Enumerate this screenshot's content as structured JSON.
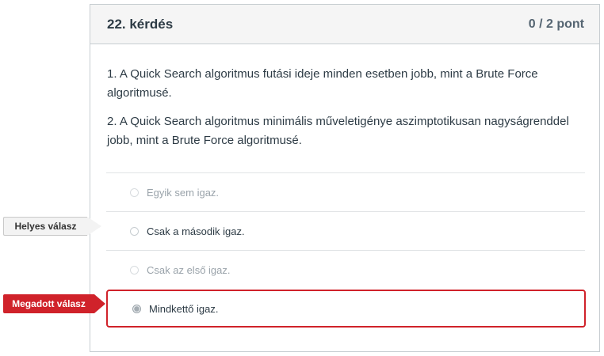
{
  "question": {
    "title": "22. kérdés",
    "points": "0 / 2 pont",
    "statements": [
      "1. A Quick Search algoritmus futási ideje minden esetben jobb, mint a Brute Force algoritmusé.",
      "2. A Quick Search algoritmus minimális műveletigénye aszimptotikusan nagyságrenddel jobb, mint a Brute Force algoritmusé."
    ]
  },
  "answers": [
    {
      "label": "Egyik sem igaz."
    },
    {
      "label": "Csak a második igaz."
    },
    {
      "label": "Csak az első igaz."
    },
    {
      "label": "Mindkettő igaz."
    }
  ],
  "tags": {
    "correct": "Helyes válasz",
    "given": "Megadott válasz"
  },
  "colors": {
    "given_border": "#d0222a",
    "correct_tag_bg": "#f3f3f3"
  }
}
